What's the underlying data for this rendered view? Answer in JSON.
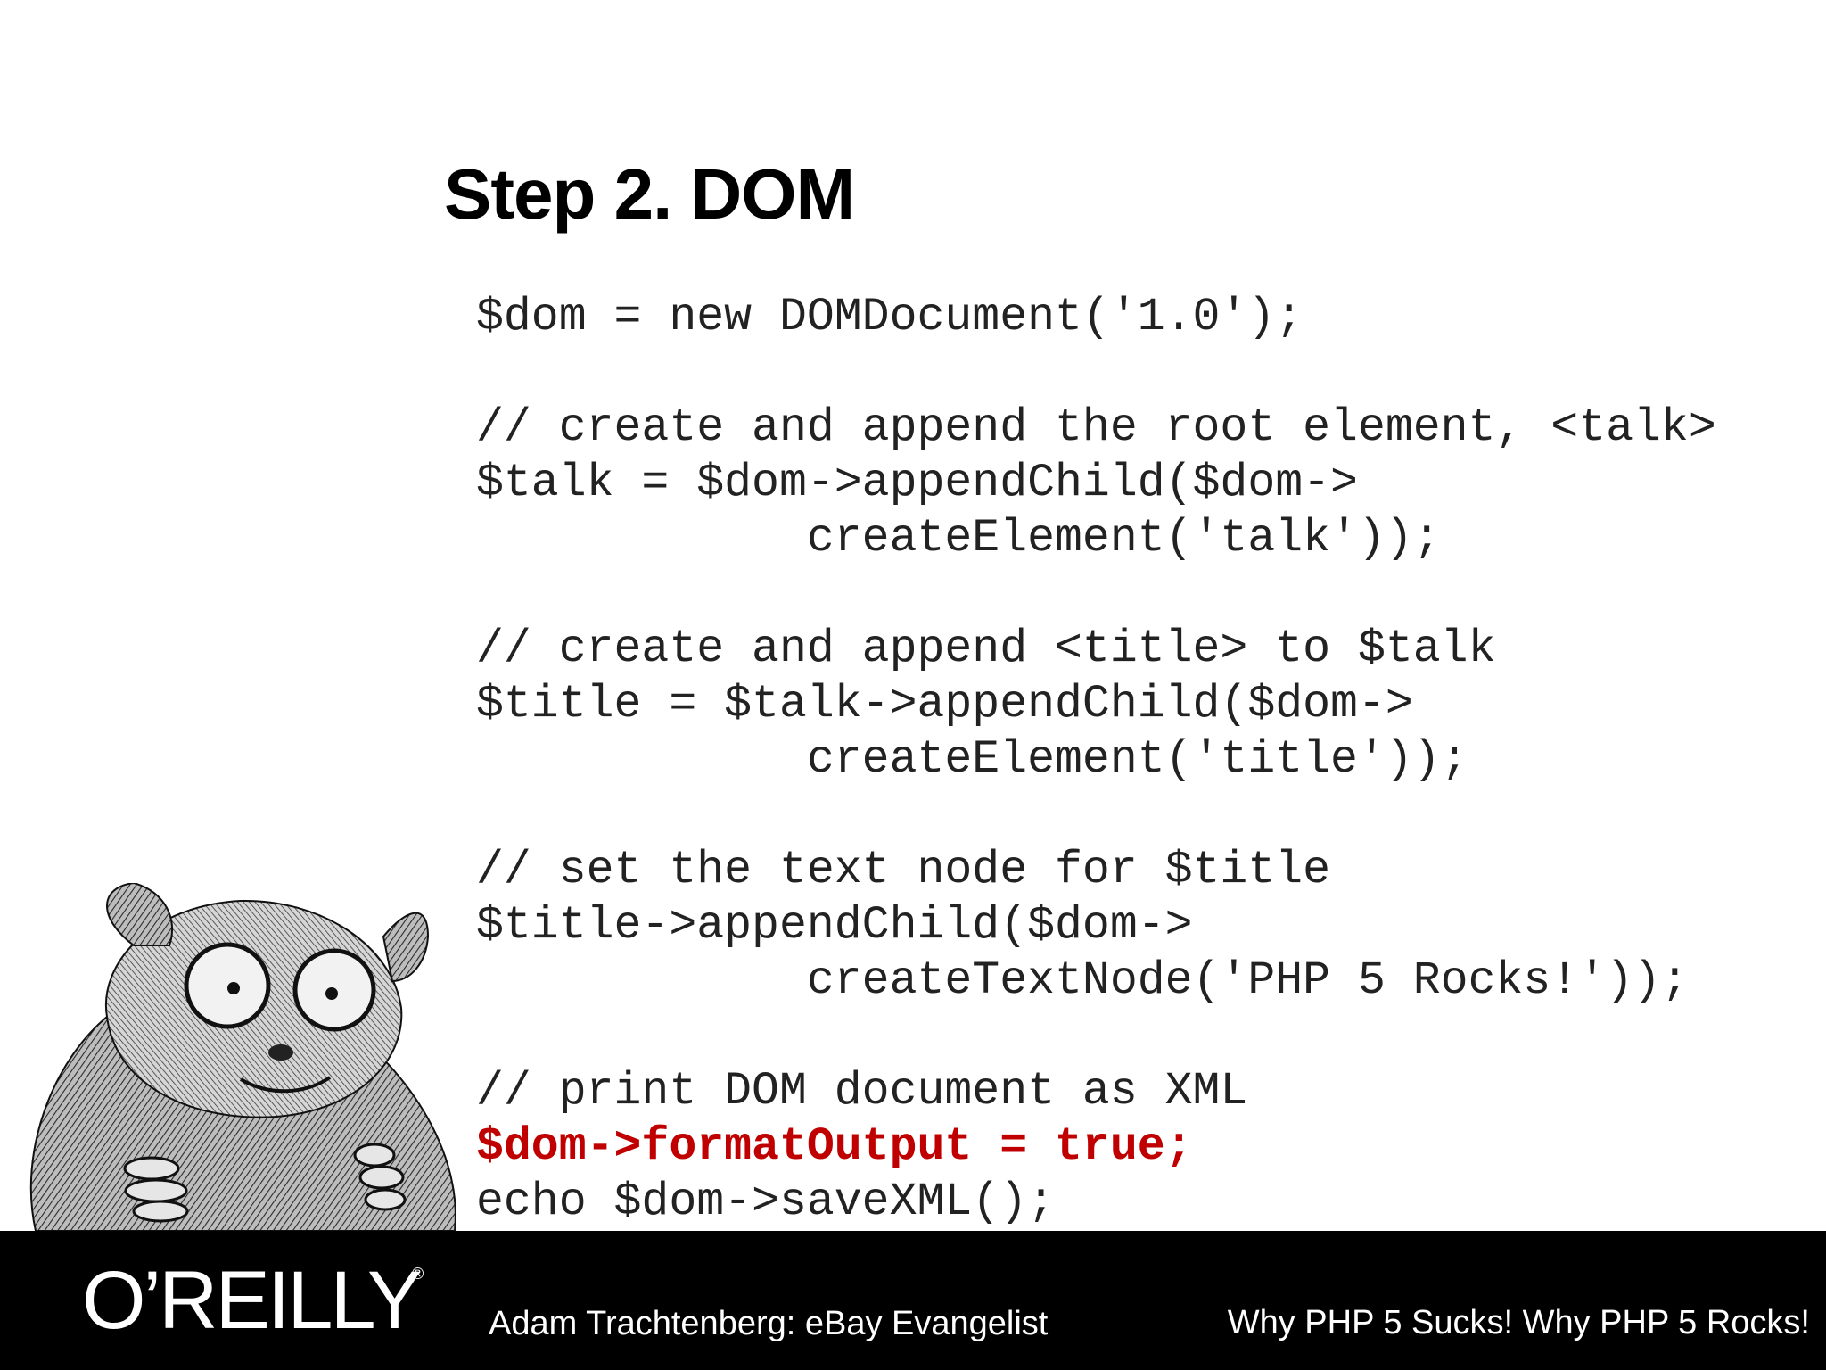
{
  "slide": {
    "title": "Step 2. DOM",
    "code_lines": [
      {
        "text": "$dom = new DOMDocument('1.0');",
        "highlight": false
      },
      {
        "text": "",
        "highlight": false
      },
      {
        "text": "// create and append the root element, <talk>",
        "highlight": false
      },
      {
        "text": "$talk = $dom->appendChild($dom->",
        "highlight": false
      },
      {
        "text": "            createElement('talk'));",
        "highlight": false
      },
      {
        "text": "",
        "highlight": false
      },
      {
        "text": "// create and append <title> to $talk",
        "highlight": false
      },
      {
        "text": "$title = $talk->appendChild($dom->",
        "highlight": false
      },
      {
        "text": "            createElement('title'));",
        "highlight": false
      },
      {
        "text": "",
        "highlight": false
      },
      {
        "text": "// set the text node for $title",
        "highlight": false
      },
      {
        "text": "$title->appendChild($dom->",
        "highlight": false
      },
      {
        "text": "            createTextNode('PHP 5 Rocks!'));",
        "highlight": false
      },
      {
        "text": "",
        "highlight": false
      },
      {
        "text": "// print DOM document as XML",
        "highlight": false
      },
      {
        "text": "$dom->formatOutput = true;",
        "highlight": true
      },
      {
        "text": "echo $dom->saveXML();",
        "highlight": false
      }
    ]
  },
  "footer": {
    "logo": "O’REILLY",
    "logo_mark": "®",
    "author": "Adam Trachtenberg: eBay Evangelist",
    "talk_title": "Why PHP 5 Sucks! Why PHP 5 Rocks!"
  },
  "colors": {
    "background": "#ffffff",
    "text": "#222222",
    "highlight": "#c00000",
    "footer": "#000000"
  },
  "icons": {
    "mascot": "tarsier-illustration"
  }
}
